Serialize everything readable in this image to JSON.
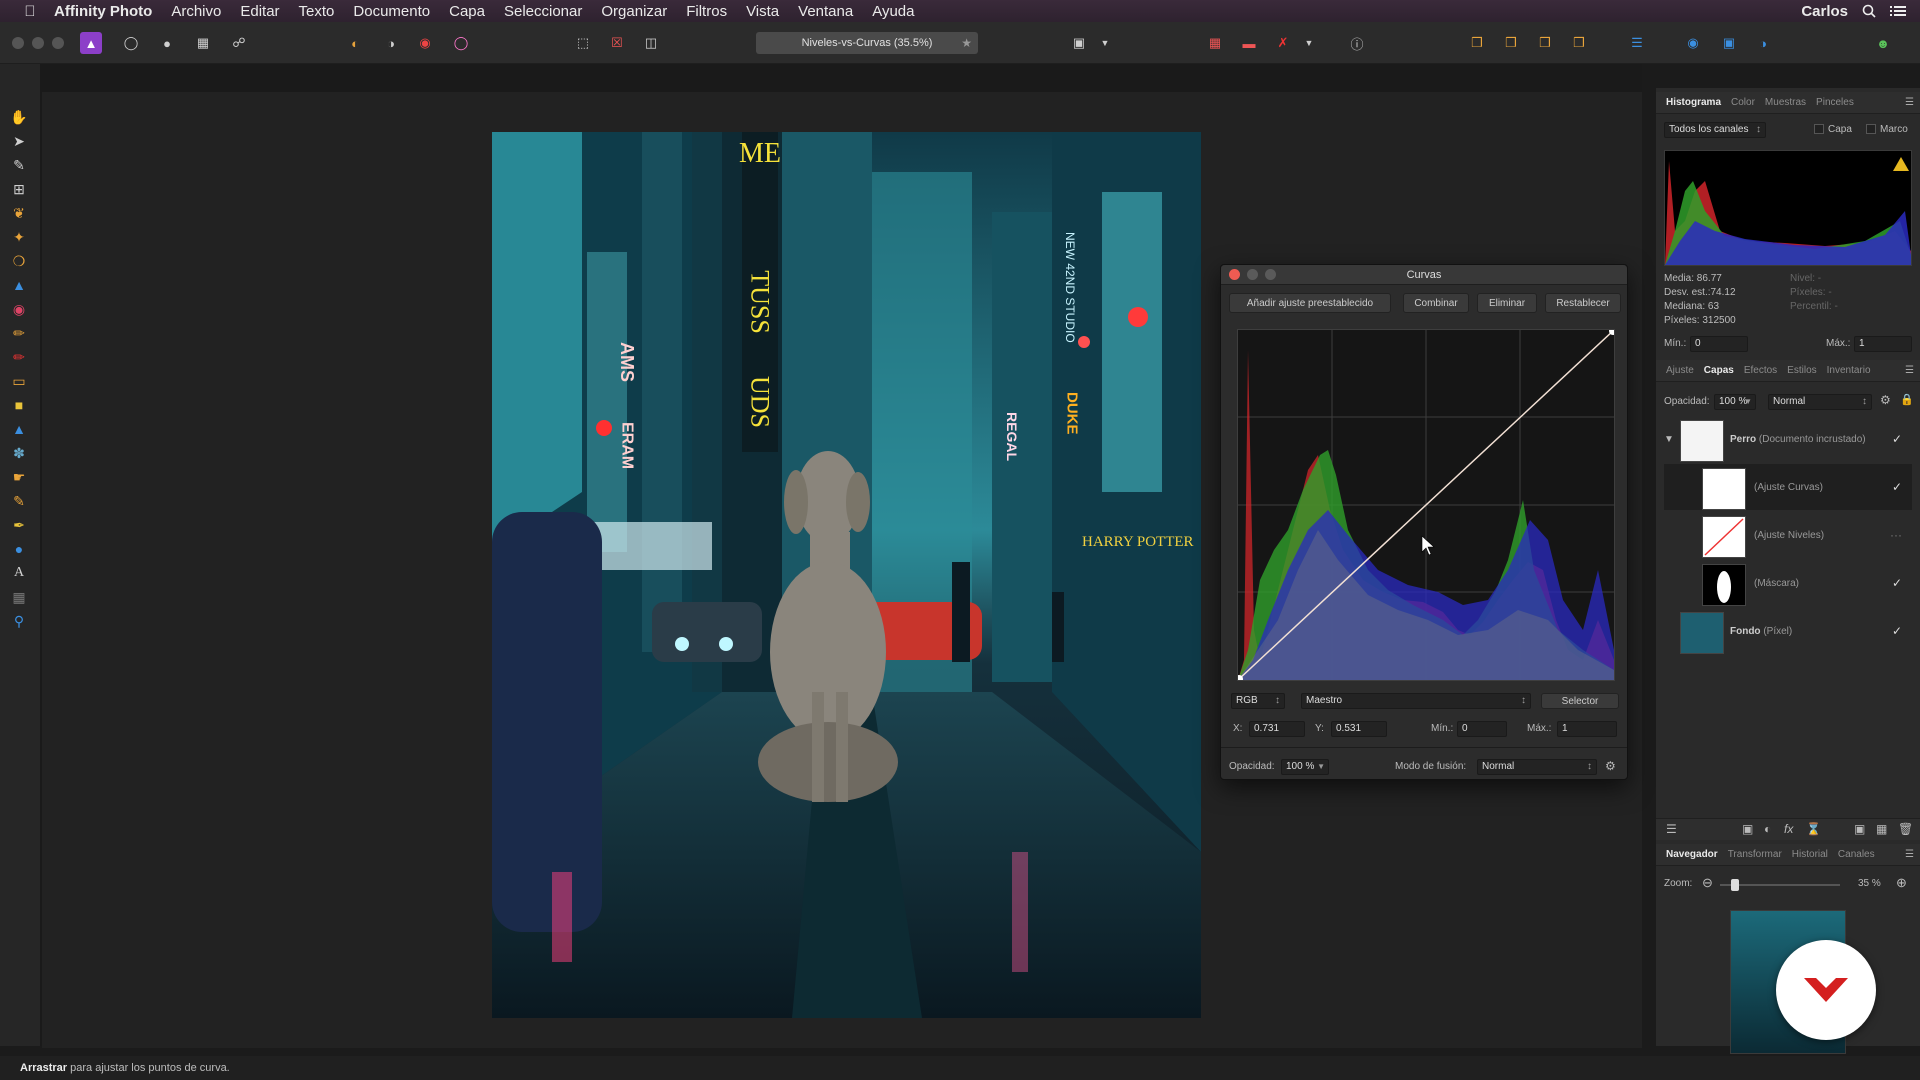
{
  "menubar": {
    "app": "Affinity Photo",
    "items": [
      "Archivo",
      "Editar",
      "Texto",
      "Documento",
      "Capa",
      "Seleccionar",
      "Organizar",
      "Filtros",
      "Vista",
      "Ventana",
      "Ayuda"
    ],
    "user": "Carlos"
  },
  "toolbar": {
    "doc_title": "Niveles-vs-Curvas (35.5%)"
  },
  "photo": {
    "signs": [
      "ME",
      "TUSS",
      "UDS",
      "AMS",
      "ERAM",
      "DUKE",
      "HARRY POTTER",
      "NEW 42ND STUDIO",
      "REGAL"
    ]
  },
  "curves": {
    "title": "Curvas",
    "buttons": [
      "Añadir ajuste preestablecido",
      "Combinar",
      "Eliminar",
      "Restablecer"
    ],
    "channel": "RGB",
    "mode": "Maestro",
    "picker": "Selector",
    "x_label": "X:",
    "x_value": "0.731",
    "y_label": "Y:",
    "y_value": "0.531",
    "min_label": "Mín.:",
    "min_value": "0",
    "max_label": "Máx.:",
    "max_value": "1",
    "opacity_label": "Opacidad:",
    "opacity_value": "100 %",
    "blend_label": "Modo de fusión:",
    "blend_value": "Normal",
    "curve_points": [
      [
        0,
        0
      ],
      [
        1,
        1
      ]
    ]
  },
  "histogram_panel": {
    "tabs": [
      "Histograma",
      "Color",
      "Muestras",
      "Pinceles"
    ],
    "channels": "Todos los canales",
    "layer_label": "Capa",
    "frame_label": "Marco",
    "stats": [
      "Media: 86.77",
      "Desv. est.:74.12",
      "Mediana: 63",
      "Píxeles: 312500"
    ],
    "stats_right": [
      "Nivel: -",
      "Píxeles: -",
      "Percentil: -"
    ],
    "min_label": "Mín.:",
    "min_value": "0",
    "max_label": "Máx.:",
    "max_value": "1"
  },
  "layers_panel": {
    "tabs": [
      "Ajuste",
      "Capas",
      "Efectos",
      "Estilos",
      "Inventario"
    ],
    "opacity_label": "Opacidad:",
    "opacity_value": "100 %",
    "blend_value": "Normal",
    "layers": [
      {
        "name": "Perro",
        "type": "(Documento incrustado)",
        "checked": "✓"
      },
      {
        "name": "",
        "type": "(Ajuste Curvas)",
        "checked": "✓"
      },
      {
        "name": "",
        "type": "(Ajuste Niveles)",
        "checked": "···"
      },
      {
        "name": "",
        "type": "(Máscara)",
        "checked": "✓"
      },
      {
        "name": "Fondo",
        "type": "(Píxel)",
        "checked": "✓"
      }
    ]
  },
  "navigator_panel": {
    "tabs": [
      "Navegador",
      "Transformar",
      "Historial",
      "Canales"
    ],
    "zoom_label": "Zoom:",
    "zoom_value": "35 %",
    "zoom_level": 0.1
  },
  "status": {
    "bold": "Arrastrar",
    "text": " para ajustar los puntos de curva."
  },
  "colors": {
    "accent": "#f2e0d4",
    "histo_red": "#d0252a",
    "histo_green": "#2f9f2a",
    "histo_blue": "#2a2ac0"
  }
}
